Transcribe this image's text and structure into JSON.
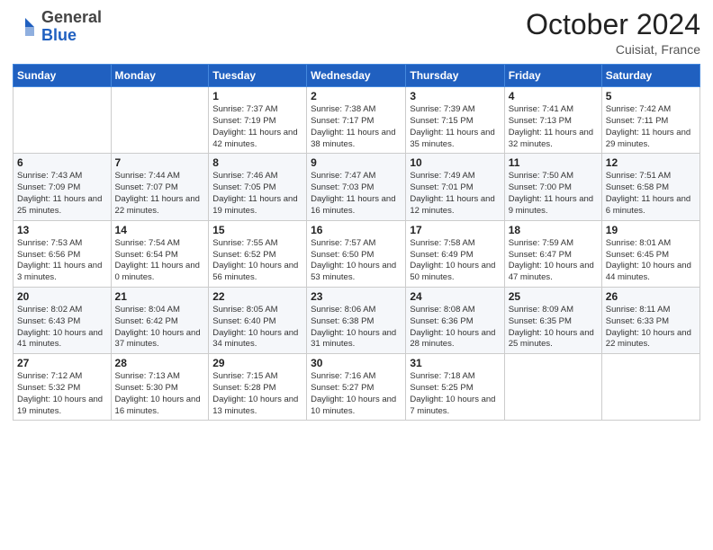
{
  "header": {
    "logo_general": "General",
    "logo_blue": "Blue",
    "title": "October 2024",
    "location": "Cuisiat, France"
  },
  "weekdays": [
    "Sunday",
    "Monday",
    "Tuesday",
    "Wednesday",
    "Thursday",
    "Friday",
    "Saturday"
  ],
  "weeks": [
    [
      {
        "day": "",
        "info": ""
      },
      {
        "day": "",
        "info": ""
      },
      {
        "day": "1",
        "info": "Sunrise: 7:37 AM\nSunset: 7:19 PM\nDaylight: 11 hours and 42 minutes."
      },
      {
        "day": "2",
        "info": "Sunrise: 7:38 AM\nSunset: 7:17 PM\nDaylight: 11 hours and 38 minutes."
      },
      {
        "day": "3",
        "info": "Sunrise: 7:39 AM\nSunset: 7:15 PM\nDaylight: 11 hours and 35 minutes."
      },
      {
        "day": "4",
        "info": "Sunrise: 7:41 AM\nSunset: 7:13 PM\nDaylight: 11 hours and 32 minutes."
      },
      {
        "day": "5",
        "info": "Sunrise: 7:42 AM\nSunset: 7:11 PM\nDaylight: 11 hours and 29 minutes."
      }
    ],
    [
      {
        "day": "6",
        "info": "Sunrise: 7:43 AM\nSunset: 7:09 PM\nDaylight: 11 hours and 25 minutes."
      },
      {
        "day": "7",
        "info": "Sunrise: 7:44 AM\nSunset: 7:07 PM\nDaylight: 11 hours and 22 minutes."
      },
      {
        "day": "8",
        "info": "Sunrise: 7:46 AM\nSunset: 7:05 PM\nDaylight: 11 hours and 19 minutes."
      },
      {
        "day": "9",
        "info": "Sunrise: 7:47 AM\nSunset: 7:03 PM\nDaylight: 11 hours and 16 minutes."
      },
      {
        "day": "10",
        "info": "Sunrise: 7:49 AM\nSunset: 7:01 PM\nDaylight: 11 hours and 12 minutes."
      },
      {
        "day": "11",
        "info": "Sunrise: 7:50 AM\nSunset: 7:00 PM\nDaylight: 11 hours and 9 minutes."
      },
      {
        "day": "12",
        "info": "Sunrise: 7:51 AM\nSunset: 6:58 PM\nDaylight: 11 hours and 6 minutes."
      }
    ],
    [
      {
        "day": "13",
        "info": "Sunrise: 7:53 AM\nSunset: 6:56 PM\nDaylight: 11 hours and 3 minutes."
      },
      {
        "day": "14",
        "info": "Sunrise: 7:54 AM\nSunset: 6:54 PM\nDaylight: 11 hours and 0 minutes."
      },
      {
        "day": "15",
        "info": "Sunrise: 7:55 AM\nSunset: 6:52 PM\nDaylight: 10 hours and 56 minutes."
      },
      {
        "day": "16",
        "info": "Sunrise: 7:57 AM\nSunset: 6:50 PM\nDaylight: 10 hours and 53 minutes."
      },
      {
        "day": "17",
        "info": "Sunrise: 7:58 AM\nSunset: 6:49 PM\nDaylight: 10 hours and 50 minutes."
      },
      {
        "day": "18",
        "info": "Sunrise: 7:59 AM\nSunset: 6:47 PM\nDaylight: 10 hours and 47 minutes."
      },
      {
        "day": "19",
        "info": "Sunrise: 8:01 AM\nSunset: 6:45 PM\nDaylight: 10 hours and 44 minutes."
      }
    ],
    [
      {
        "day": "20",
        "info": "Sunrise: 8:02 AM\nSunset: 6:43 PM\nDaylight: 10 hours and 41 minutes."
      },
      {
        "day": "21",
        "info": "Sunrise: 8:04 AM\nSunset: 6:42 PM\nDaylight: 10 hours and 37 minutes."
      },
      {
        "day": "22",
        "info": "Sunrise: 8:05 AM\nSunset: 6:40 PM\nDaylight: 10 hours and 34 minutes."
      },
      {
        "day": "23",
        "info": "Sunrise: 8:06 AM\nSunset: 6:38 PM\nDaylight: 10 hours and 31 minutes."
      },
      {
        "day": "24",
        "info": "Sunrise: 8:08 AM\nSunset: 6:36 PM\nDaylight: 10 hours and 28 minutes."
      },
      {
        "day": "25",
        "info": "Sunrise: 8:09 AM\nSunset: 6:35 PM\nDaylight: 10 hours and 25 minutes."
      },
      {
        "day": "26",
        "info": "Sunrise: 8:11 AM\nSunset: 6:33 PM\nDaylight: 10 hours and 22 minutes."
      }
    ],
    [
      {
        "day": "27",
        "info": "Sunrise: 7:12 AM\nSunset: 5:32 PM\nDaylight: 10 hours and 19 minutes."
      },
      {
        "day": "28",
        "info": "Sunrise: 7:13 AM\nSunset: 5:30 PM\nDaylight: 10 hours and 16 minutes."
      },
      {
        "day": "29",
        "info": "Sunrise: 7:15 AM\nSunset: 5:28 PM\nDaylight: 10 hours and 13 minutes."
      },
      {
        "day": "30",
        "info": "Sunrise: 7:16 AM\nSunset: 5:27 PM\nDaylight: 10 hours and 10 minutes."
      },
      {
        "day": "31",
        "info": "Sunrise: 7:18 AM\nSunset: 5:25 PM\nDaylight: 10 hours and 7 minutes."
      },
      {
        "day": "",
        "info": ""
      },
      {
        "day": "",
        "info": ""
      }
    ]
  ]
}
